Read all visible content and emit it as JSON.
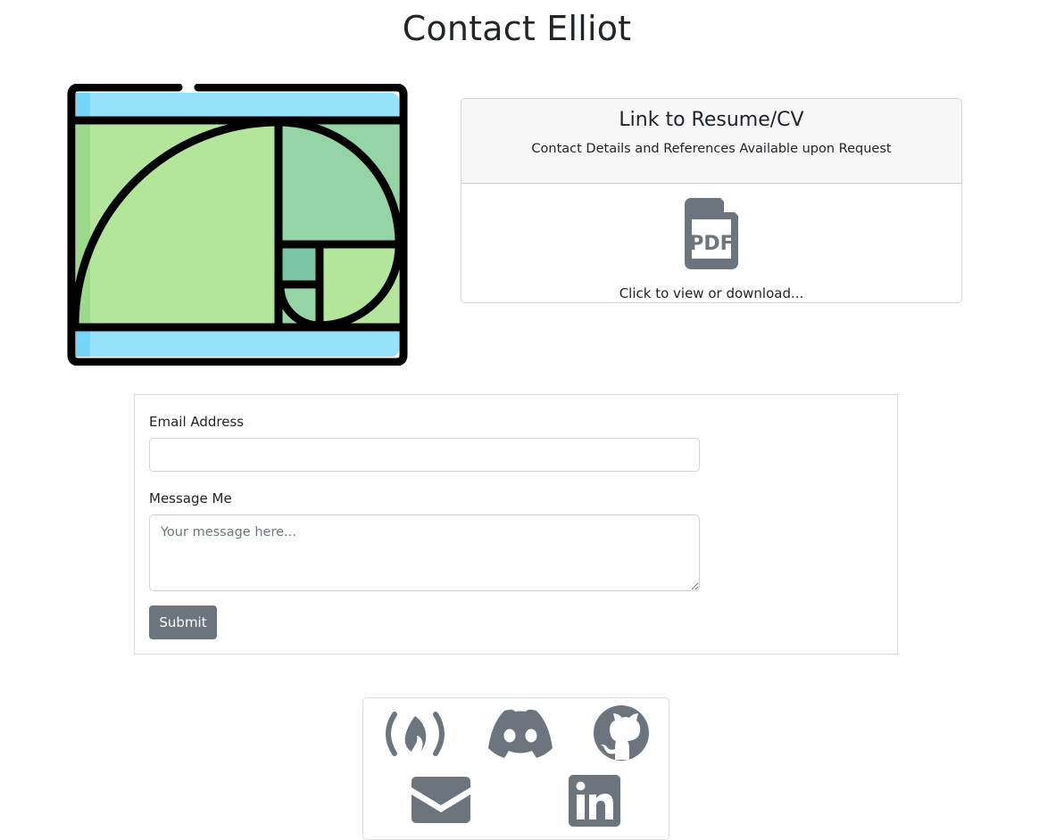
{
  "page": {
    "title": "Contact Elliot"
  },
  "resume": {
    "title": "Link to Resume/CV",
    "subtitle": "Contact Details and References Available upon Request",
    "pdf_label": "PDF",
    "caption": "Click to view or download..."
  },
  "form": {
    "email_label": "Email Address",
    "email_value": "",
    "message_label": "Message Me",
    "message_placeholder": "Your message here...",
    "submit_label": "Submit"
  },
  "social": {
    "items": [
      {
        "name": "freecodecamp",
        "icon": "freecodecamp-icon"
      },
      {
        "name": "discord",
        "icon": "discord-icon"
      },
      {
        "name": "github",
        "icon": "github-icon"
      },
      {
        "name": "email",
        "icon": "envelope-icon"
      },
      {
        "name": "linkedin",
        "icon": "linkedin-icon"
      }
    ]
  },
  "colors": {
    "icon_gray": "#6c757d",
    "logo_sky": "#97e2fb",
    "logo_green_light": "#b3e59b",
    "logo_green_mid": "#95d5a5",
    "logo_green_dark": "#7ac4a4",
    "button_gray": "#6c757d"
  }
}
